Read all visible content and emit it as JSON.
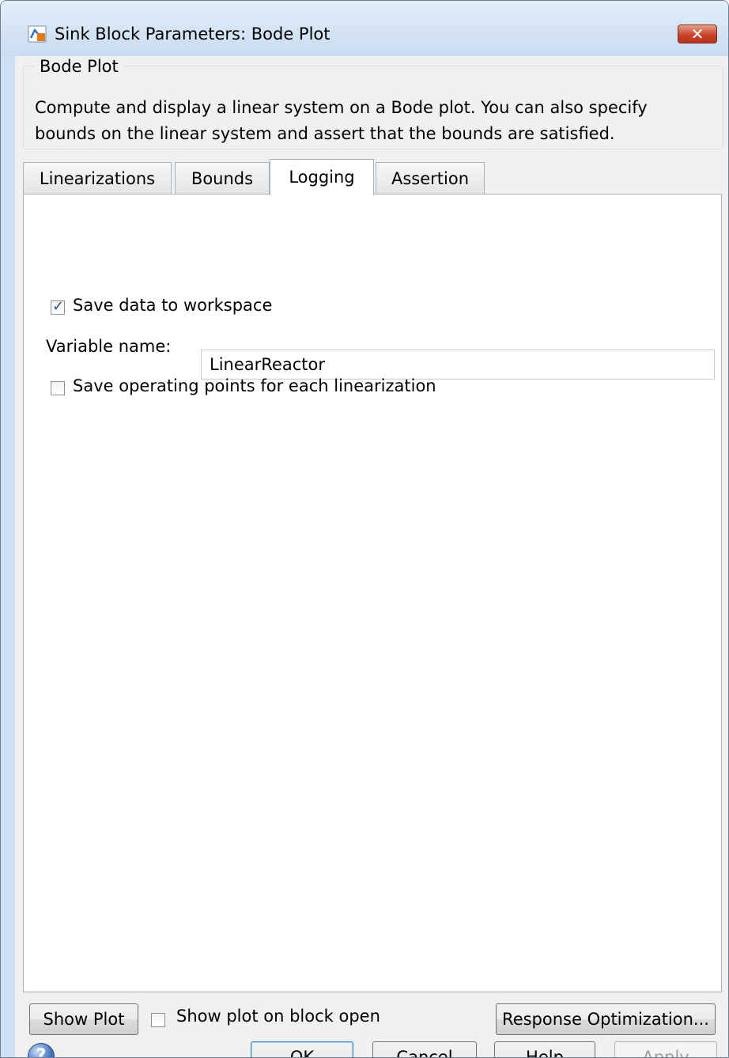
{
  "window": {
    "title": "Sink Block Parameters: Bode Plot",
    "close_symbol": "✕",
    "accent_color": "#c8432a"
  },
  "group": {
    "legend": "Bode Plot",
    "line1": "Compute and display a linear system on a Bode plot. You can also specify",
    "line2": "bounds on the linear system and assert that the bounds are satisfied."
  },
  "tabs": [
    {
      "label": "Linearizations",
      "active": false
    },
    {
      "label": "Bounds",
      "active": false
    },
    {
      "label": "Logging",
      "active": true
    },
    {
      "label": "Assertion",
      "active": false
    }
  ],
  "logging": {
    "save_data": {
      "label": "Save data to workspace",
      "checked": true
    },
    "variable_name": {
      "label": "Variable name:",
      "value": "LinearReactor"
    },
    "save_op_points": {
      "label": "Save operating points for each linearization",
      "checked": false
    }
  },
  "bottom": {
    "show_plot": "Show Plot",
    "show_on_open": {
      "label": "Show plot on block open",
      "checked": false
    },
    "response_optimization": "Response Optimization..."
  },
  "dialog_buttons": {
    "help_icon_glyph": "?",
    "ok": "OK",
    "cancel": "Cancel",
    "help": "Help",
    "apply": "Apply"
  }
}
